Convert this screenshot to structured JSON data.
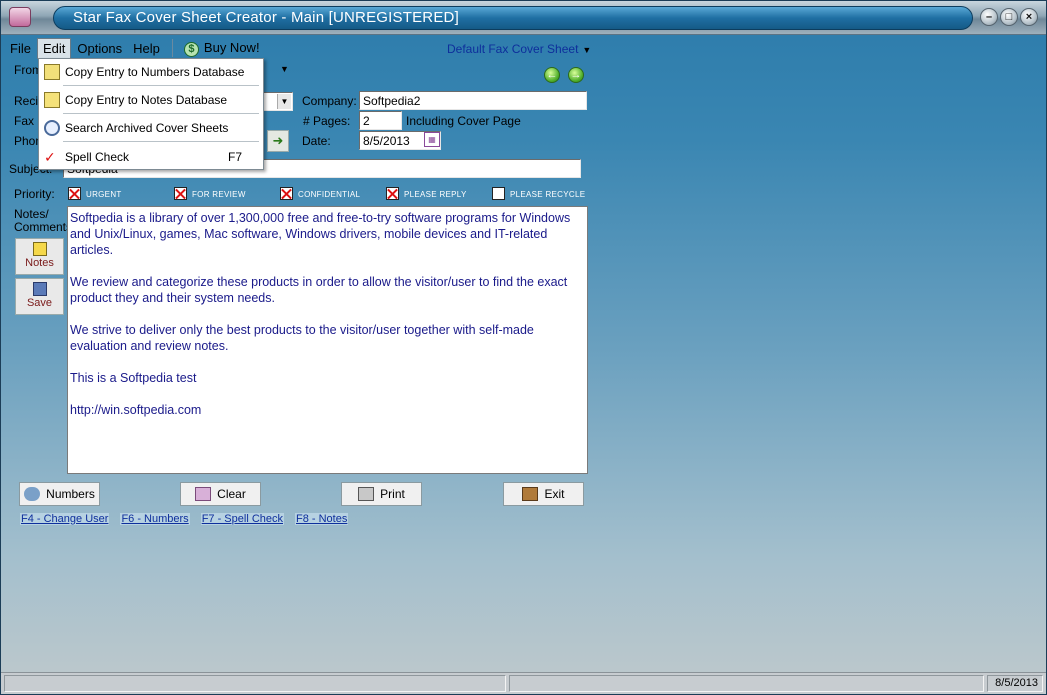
{
  "window": {
    "title": "Star Fax Cover Sheet Creator - Main [UNREGISTERED]",
    "controls": [
      "minimize",
      "maximize",
      "close"
    ]
  },
  "menubar": {
    "items": [
      "File",
      "Edit",
      "Options",
      "Help"
    ],
    "buy_now": "Buy Now!",
    "default_sheet": "Default Fax Cover Sheet"
  },
  "edit_menu": {
    "items": [
      {
        "label": "Copy Entry to Numbers Database",
        "shortcut": "",
        "icon": "copy-green-arrow-icon"
      },
      {
        "label": "Copy Entry to Notes Database",
        "shortcut": "",
        "icon": "note-icon"
      },
      {
        "label": "Search Archived Cover Sheets",
        "shortcut": "",
        "icon": "magnifier-icon"
      },
      {
        "label": "Spell Check",
        "shortcut": "F7",
        "icon": "spell-check-icon"
      }
    ]
  },
  "form": {
    "from_label": "From",
    "recipient_label": "Recip",
    "fax_label": "Fax",
    "phone_label": "Phon",
    "subject_label": "Subject:",
    "subject_value": "Softpedia",
    "company_label": "Company:",
    "company_value": "Softpedia2",
    "pages_label": "# Pages:",
    "pages_value": "2",
    "pages_suffix": "Including Cover Page",
    "date_label": "Date:",
    "date_value": "8/5/2013",
    "priority_label": "Priority:",
    "notes_label_1": "Notes/",
    "notes_label_2": "Comments:"
  },
  "priority": [
    {
      "label": "URGENT",
      "checked": true
    },
    {
      "label": "FOR REVIEW",
      "checked": true
    },
    {
      "label": "CONFIDENTIAL",
      "checked": true
    },
    {
      "label": "PLEASE REPLY",
      "checked": true
    },
    {
      "label": "PLEASE RECYCLE",
      "checked": false
    }
  ],
  "comments": {
    "paragraphs": [
      "Softpedia is a library of over 1,300,000 free and free-to-try software programs for Windows and Unix/Linux, games, Mac software, Windows drivers, mobile devices and IT-related articles.",
      "We review and categorize these products in order to allow the visitor/user to find the exact product they and their system needs.",
      "We strive to deliver only the best products to the visitor/user together with self-made evaluation and review notes.",
      "This is a Softpedia test",
      "http://win.softpedia.com"
    ]
  },
  "side_buttons": {
    "notes": "Notes",
    "save": "Save"
  },
  "bottom_buttons": {
    "numbers": "Numbers",
    "clear": "Clear",
    "print": "Print",
    "exit": "Exit"
  },
  "hotkeys": [
    "F4 - Change User",
    "F6 - Numbers",
    "F7 - Spell Check",
    "F8 - Notes"
  ],
  "statusbar": {
    "date": "8/5/2013"
  },
  "colors": {
    "accent": "#1f6fa3",
    "link": "#0e2f9c",
    "comment_text": "#1a1a8a",
    "check_mark": "#d11111"
  }
}
